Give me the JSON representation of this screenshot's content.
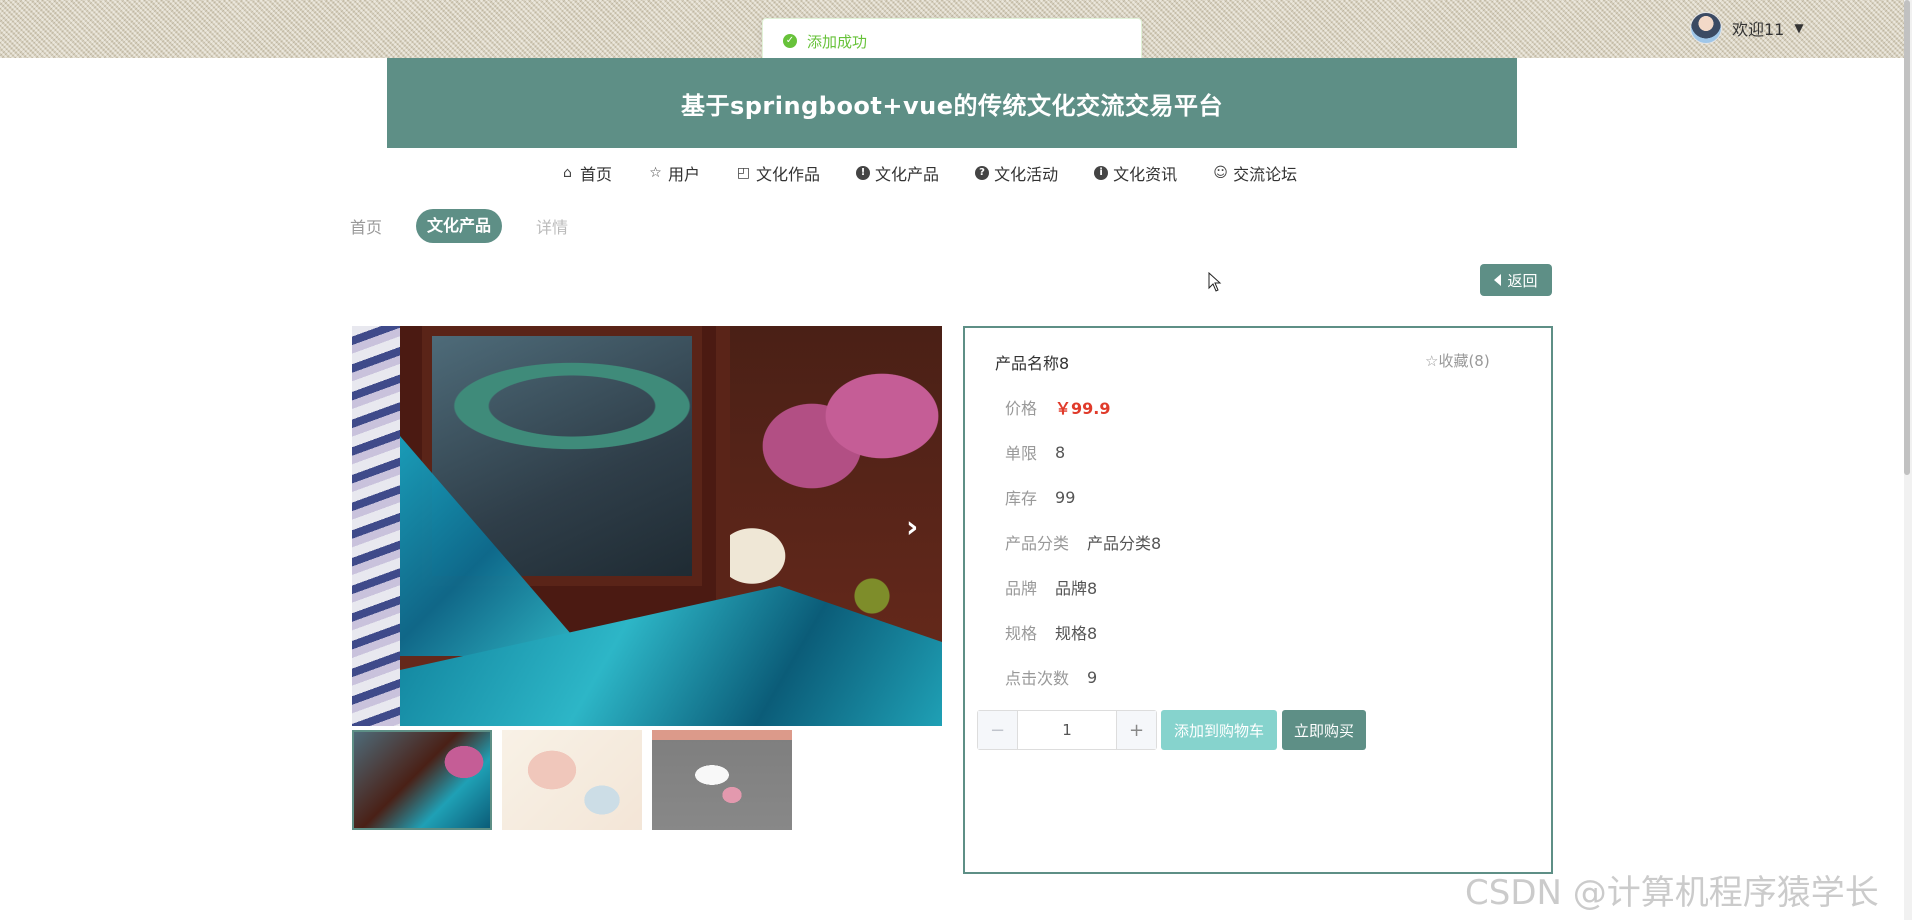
{
  "user": {
    "greeting": "欢迎11"
  },
  "toast": {
    "message": "添加成功"
  },
  "site": {
    "title": "基于springboot+vue的传统文化交流交易平台"
  },
  "nav": {
    "items": [
      {
        "label": "首页",
        "icon": "home-icon"
      },
      {
        "label": "用户",
        "icon": "star-icon"
      },
      {
        "label": "文化作品",
        "icon": "bag-icon"
      },
      {
        "label": "文化产品",
        "icon": "alert-icon"
      },
      {
        "label": "文化活动",
        "icon": "question-icon"
      },
      {
        "label": "文化资讯",
        "icon": "info-icon"
      },
      {
        "label": "交流论坛",
        "icon": "smile-icon"
      }
    ]
  },
  "breadcrumb": {
    "home": "首页",
    "category": "文化产品",
    "current": "详情"
  },
  "back_label": "返回",
  "product": {
    "name": "产品名称8",
    "favorite": "收藏(8)",
    "fields": [
      {
        "label": "价格",
        "value": "￥99.9"
      },
      {
        "label": "单限",
        "value": "8"
      },
      {
        "label": "库存",
        "value": "99"
      },
      {
        "label": "产品分类",
        "value": "产品分类8"
      },
      {
        "label": "品牌",
        "value": "品牌8"
      },
      {
        "label": "规格",
        "value": "规格8"
      },
      {
        "label": "点击次数",
        "value": "9"
      }
    ],
    "quantity": "1",
    "add_to_cart": "添加到购物车",
    "buy_now": "立即购买"
  },
  "watermark": "CSDN @计算机程序猿学长"
}
